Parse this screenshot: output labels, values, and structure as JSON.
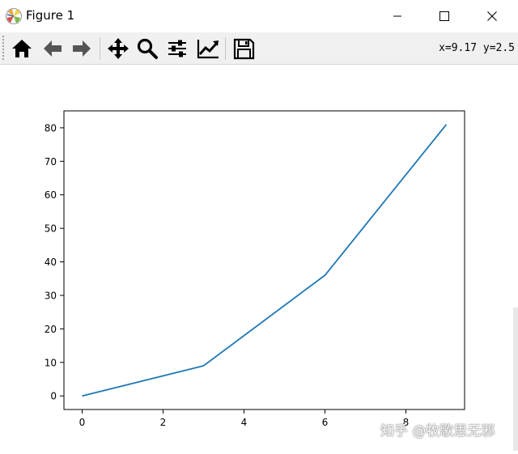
{
  "window": {
    "title": "Figure 1",
    "buttons": [
      "minimize",
      "maximize",
      "close"
    ]
  },
  "toolbar": {
    "tools": [
      {
        "name": "home",
        "icon": "home-icon"
      },
      {
        "name": "back",
        "icon": "arrow-left-icon"
      },
      {
        "name": "forward",
        "icon": "arrow-right-icon"
      },
      {
        "name": "pan",
        "icon": "move-icon"
      },
      {
        "name": "zoom",
        "icon": "magnifier-icon"
      },
      {
        "name": "subplots",
        "icon": "sliders-icon"
      },
      {
        "name": "edit-axes",
        "icon": "line-chart-icon"
      },
      {
        "name": "save",
        "icon": "floppy-disk-icon"
      }
    ],
    "coords": "x=9.17 y=2.5"
  },
  "chart_data": {
    "type": "line",
    "x": [
      0,
      3,
      6,
      9
    ],
    "series": [
      {
        "values": [
          0,
          9,
          36,
          81
        ],
        "color": "#1f77b4"
      }
    ],
    "xlim": [
      -0.45,
      9.45
    ],
    "ylim": [
      -4.05,
      85.05
    ],
    "xticks": [
      "0",
      "2",
      "4",
      "6",
      "8"
    ],
    "yticks": [
      "0",
      "10",
      "20",
      "30",
      "40",
      "50",
      "60",
      "70",
      "80"
    ],
    "grid": false,
    "title": "",
    "xlabel": "",
    "ylabel": ""
  },
  "watermark": "知乎 @牧歌思无邪"
}
